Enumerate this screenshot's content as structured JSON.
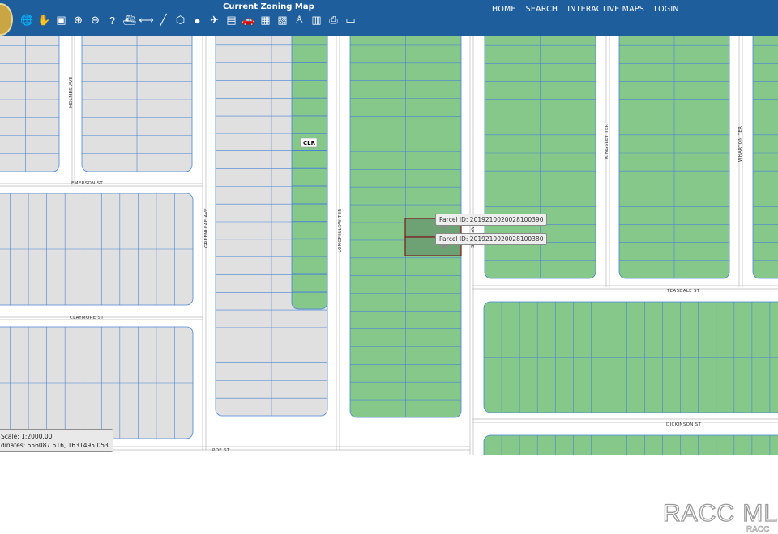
{
  "app": {
    "title": "Current Zoning Map"
  },
  "nav": [
    {
      "label": "HOME",
      "name": "nav-home"
    },
    {
      "label": "SEARCH",
      "name": "nav-search"
    },
    {
      "label": "INTERACTIVE MAPS",
      "name": "nav-interactive-maps"
    },
    {
      "label": "LOGIN",
      "name": "nav-login"
    }
  ],
  "tools": [
    {
      "icon": "globe-icon",
      "glyph": "🌐"
    },
    {
      "icon": "pan-hand-icon",
      "glyph": "✋"
    },
    {
      "icon": "full-extent-icon",
      "glyph": "▣"
    },
    {
      "icon": "zoom-in-icon",
      "glyph": "⊕"
    },
    {
      "icon": "zoom-out-icon",
      "glyph": "⊖"
    },
    {
      "icon": "help-icon",
      "glyph": "?"
    },
    {
      "icon": "ship-icon",
      "glyph": "⛴"
    },
    {
      "icon": "measure-line-icon",
      "glyph": "⟷"
    },
    {
      "icon": "draw-line-icon",
      "glyph": "╱"
    },
    {
      "icon": "polygon-icon",
      "glyph": "⬡"
    },
    {
      "icon": "circle-icon",
      "glyph": "●"
    },
    {
      "icon": "plane-icon",
      "glyph": "✈"
    },
    {
      "icon": "document-icon",
      "glyph": "▤"
    },
    {
      "icon": "car-icon",
      "glyph": "🚗"
    },
    {
      "icon": "layers-icon",
      "glyph": "▦"
    },
    {
      "icon": "map-icon",
      "glyph": "▧"
    },
    {
      "icon": "person-icon",
      "glyph": "♙"
    },
    {
      "icon": "clipboard-icon",
      "glyph": "▥"
    },
    {
      "icon": "printer-icon",
      "glyph": "⎙"
    },
    {
      "icon": "screen-icon",
      "glyph": "▭"
    }
  ],
  "colors": {
    "toolbar": "#1f5e9c",
    "zone_green": "#86c88a",
    "parcel_gray": "#e0e0e0",
    "lot_line": "#4a84d4",
    "selected_parcel": "#7a1a1a"
  },
  "streets": {
    "holmes": "HOLMES AVE",
    "emerson": "EMERSON ST",
    "greenleaf": "GREENLEAF AVE",
    "claymore": "CLAYMORE ST",
    "longfellow": "LONGFELLOW TER",
    "kingsley": "KINGSLEY TER",
    "wharton": "WHARTON TER",
    "teasdale": "TEASDALE ST",
    "dickinson": "DICKINSON ST",
    "poe": "POE ST",
    "vertical_partial": "S___E AVE"
  },
  "zones": {
    "clr": "CLR"
  },
  "parcels": [
    {
      "label": "Parcel ID: 2019210020028100390"
    },
    {
      "label": "Parcel ID: 2019210020028100380"
    }
  ],
  "status": {
    "scale": "Scale: 1:2000.00",
    "coords": "dinates: 556087.516, 1631495.053"
  },
  "watermark": {
    "main": "RACC ML",
    "sub": "RACC"
  }
}
